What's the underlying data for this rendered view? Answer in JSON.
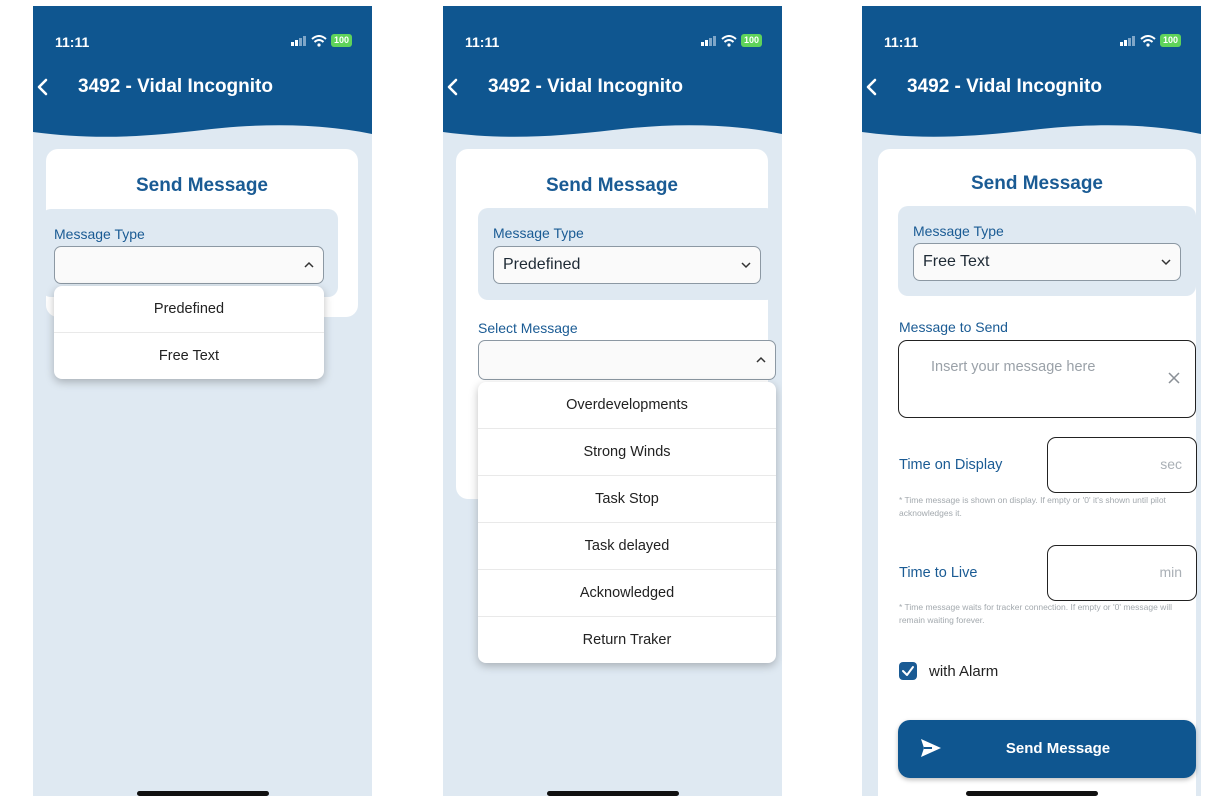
{
  "status": {
    "time": "11:11",
    "battery": "100"
  },
  "header": {
    "title": "3492 - Vidal Incognito"
  },
  "colors": {
    "primary": "#0f5690",
    "accent": "#1a5b94",
    "background": "#dfe9f2",
    "battery": "#5fd35a"
  },
  "screen1": {
    "card_title": "Send Message",
    "message_type_label": "Message Type",
    "message_type_value": "",
    "options": [
      "Predefined",
      "Free Text"
    ]
  },
  "screen2": {
    "card_title": "Send Message",
    "message_type_label": "Message Type",
    "message_type_value": "Predefined",
    "select_message_label": "Select Message",
    "select_message_value": "",
    "options": [
      "Overdevelopments",
      "Strong Winds",
      "Task Stop",
      "Task delayed",
      "Acknowledged",
      "Return Traker"
    ]
  },
  "screen3": {
    "card_title": "Send Message",
    "message_type_label": "Message Type",
    "message_type_value": "Free Text",
    "message_label": "Message to Send",
    "message_placeholder": "Insert your message here",
    "time_display_label": "Time on Display",
    "time_display_unit": "sec",
    "time_display_help": "* Time message is shown on display. If empty or '0' it's shown until pilot acknowledges it.",
    "time_live_label": "Time to Live",
    "time_live_unit": "min",
    "time_live_help": "* Time message waits for tracker connection. If empty or '0' message will remain waiting forever.",
    "alarm_label": "with Alarm",
    "alarm_checked": true,
    "send_label": "Send Message"
  }
}
